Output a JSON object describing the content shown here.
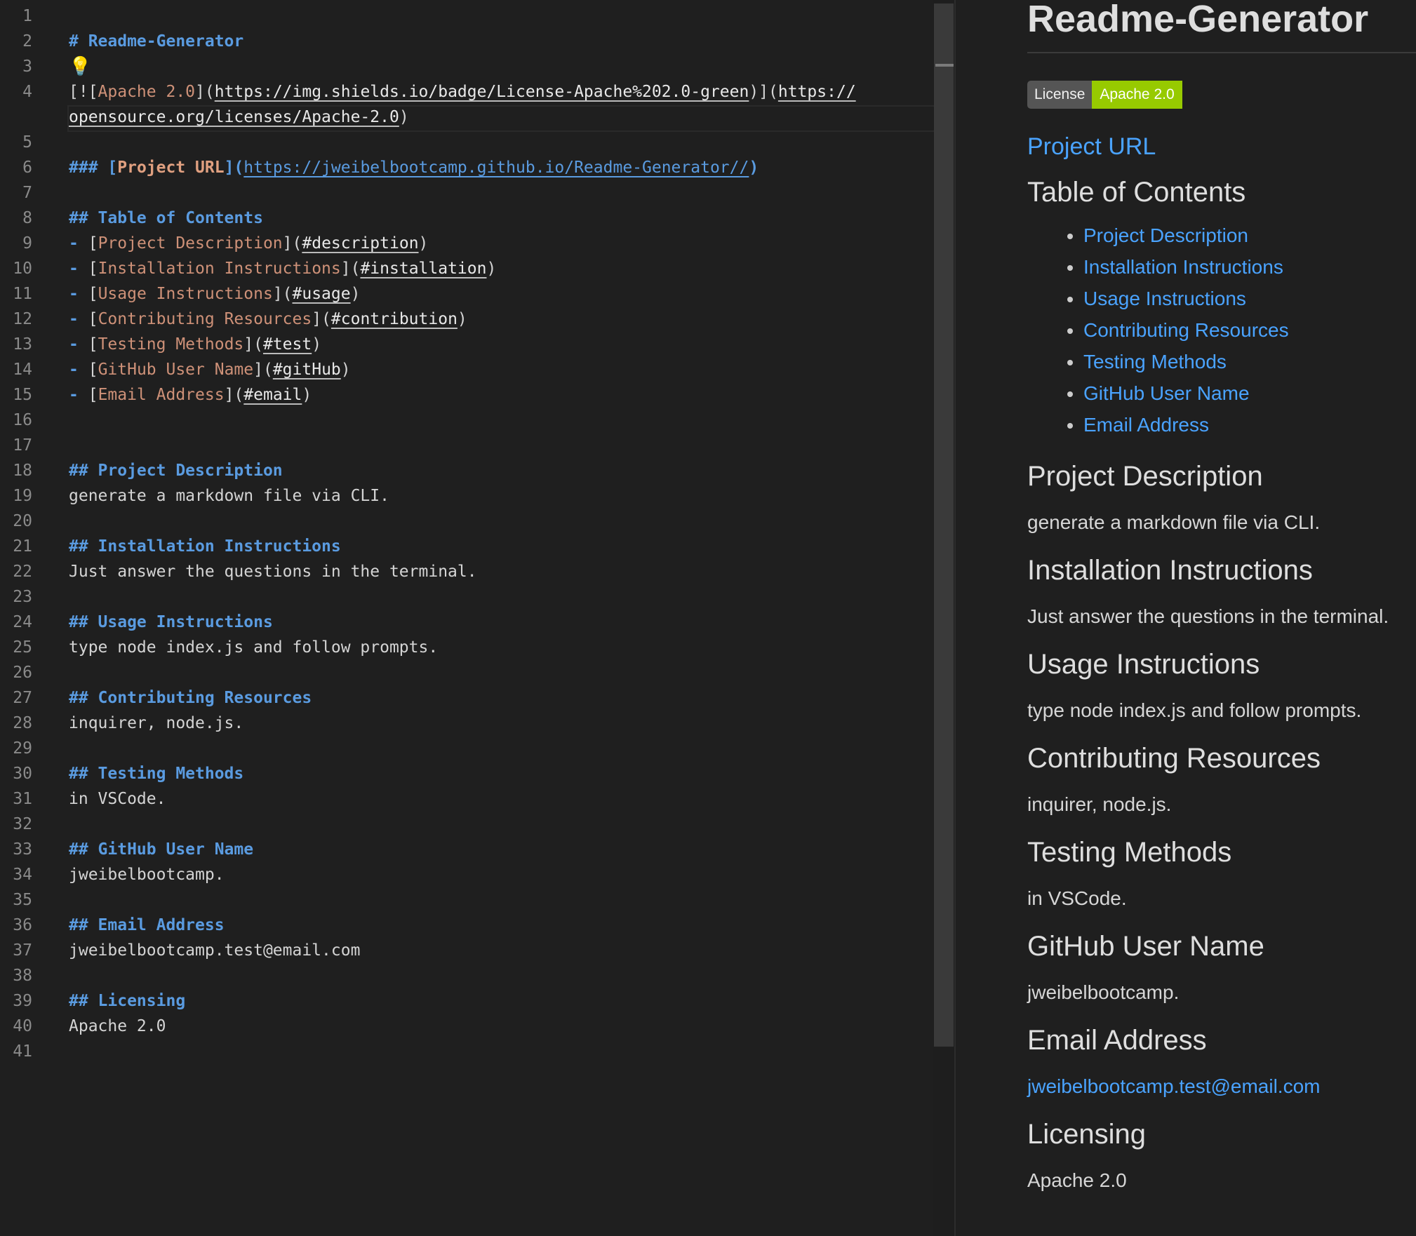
{
  "editor": {
    "line_numbers": [
      "1",
      "2",
      "3",
      "4",
      "",
      "5",
      "6",
      "7",
      "8",
      "9",
      "10",
      "11",
      "12",
      "13",
      "14",
      "15",
      "16",
      "17",
      "18",
      "19",
      "20",
      "21",
      "22",
      "23",
      "24",
      "25",
      "26",
      "27",
      "28",
      "29",
      "30",
      "31",
      "32",
      "33",
      "34",
      "35",
      "36",
      "37",
      "38",
      "39",
      "40",
      "41"
    ],
    "line2": "# Readme-Generator",
    "line3_icon": "💡",
    "line4": {
      "p1": "[![",
      "alt": "Apache 2.0",
      "p2": "](",
      "img_url": "https://img.shields.io/badge/License-Apache%202.0-green",
      "p3": ")](",
      "link_url_a": "https://",
      "link_url_b": "opensource.org/licenses/Apache-2.0",
      "p4": ")"
    },
    "line6": {
      "hash": "### ",
      "open": "[",
      "text": "Project URL",
      "mid": "](",
      "url": "https://jweibelbootcamp.github.io/Readme-Generator//",
      "close": ")"
    },
    "line8": "## Table of Contents",
    "toc": [
      {
        "text": "Project Description",
        "anchor": "#description"
      },
      {
        "text": "Installation Instructions",
        "anchor": "#installation"
      },
      {
        "text": "Usage Instructions",
        "anchor": "#usage"
      },
      {
        "text": "Contributing Resources",
        "anchor": "#contribution"
      },
      {
        "text": "Testing Methods",
        "anchor": "#test"
      },
      {
        "text": "GitHub User Name",
        "anchor": "#gitHub"
      },
      {
        "text": "Email Address",
        "anchor": "#email"
      }
    ],
    "toc_bullet": "- ",
    "sections": [
      {
        "heading": "## Project Description",
        "body": "generate a markdown file via CLI."
      },
      {
        "heading": "## Installation Instructions",
        "body": "Just answer the questions in the terminal."
      },
      {
        "heading": "## Usage Instructions",
        "body": "type node index.js and follow prompts."
      },
      {
        "heading": "## Contributing Resources",
        "body": "inquirer, node.js."
      },
      {
        "heading": "## Testing Methods",
        "body": "in VSCode."
      },
      {
        "heading": "## GitHub User Name",
        "body": "jweibelbootcamp."
      },
      {
        "heading": "## Email Address",
        "body": "jweibelbootcamp.test@email.com"
      },
      {
        "heading": "## Licensing",
        "body": "Apache 2.0"
      }
    ]
  },
  "preview": {
    "title": "Readme-Generator",
    "badge_left": "License",
    "badge_right": "Apache 2.0",
    "project_url": "Project URL",
    "toc_heading": "Table of Contents",
    "toc": [
      "Project Description",
      "Installation Instructions",
      "Usage Instructions",
      "Contributing Resources",
      "Testing Methods",
      "GitHub User Name",
      "Email Address"
    ],
    "sections": [
      {
        "heading": "Project Description",
        "body": "generate a markdown file via CLI."
      },
      {
        "heading": "Installation Instructions",
        "body": "Just answer the questions in the terminal."
      },
      {
        "heading": "Usage Instructions",
        "body": "type node index.js and follow prompts."
      },
      {
        "heading": "Contributing Resources",
        "body": "inquirer, node.js."
      },
      {
        "heading": "Testing Methods",
        "body": "in VSCode."
      },
      {
        "heading": "GitHub User Name",
        "body": "jweibelbootcamp."
      },
      {
        "heading": "Email Address",
        "body": "jweibelbootcamp.test@email.com"
      },
      {
        "heading": "Licensing",
        "body": "Apache 2.0"
      }
    ]
  },
  "colors": {
    "heading_blue": "#5a9be0",
    "link_text": "#ce9178",
    "preview_link": "#4aa3ff",
    "badge_green": "#97ca00",
    "badge_grey": "#555555"
  }
}
